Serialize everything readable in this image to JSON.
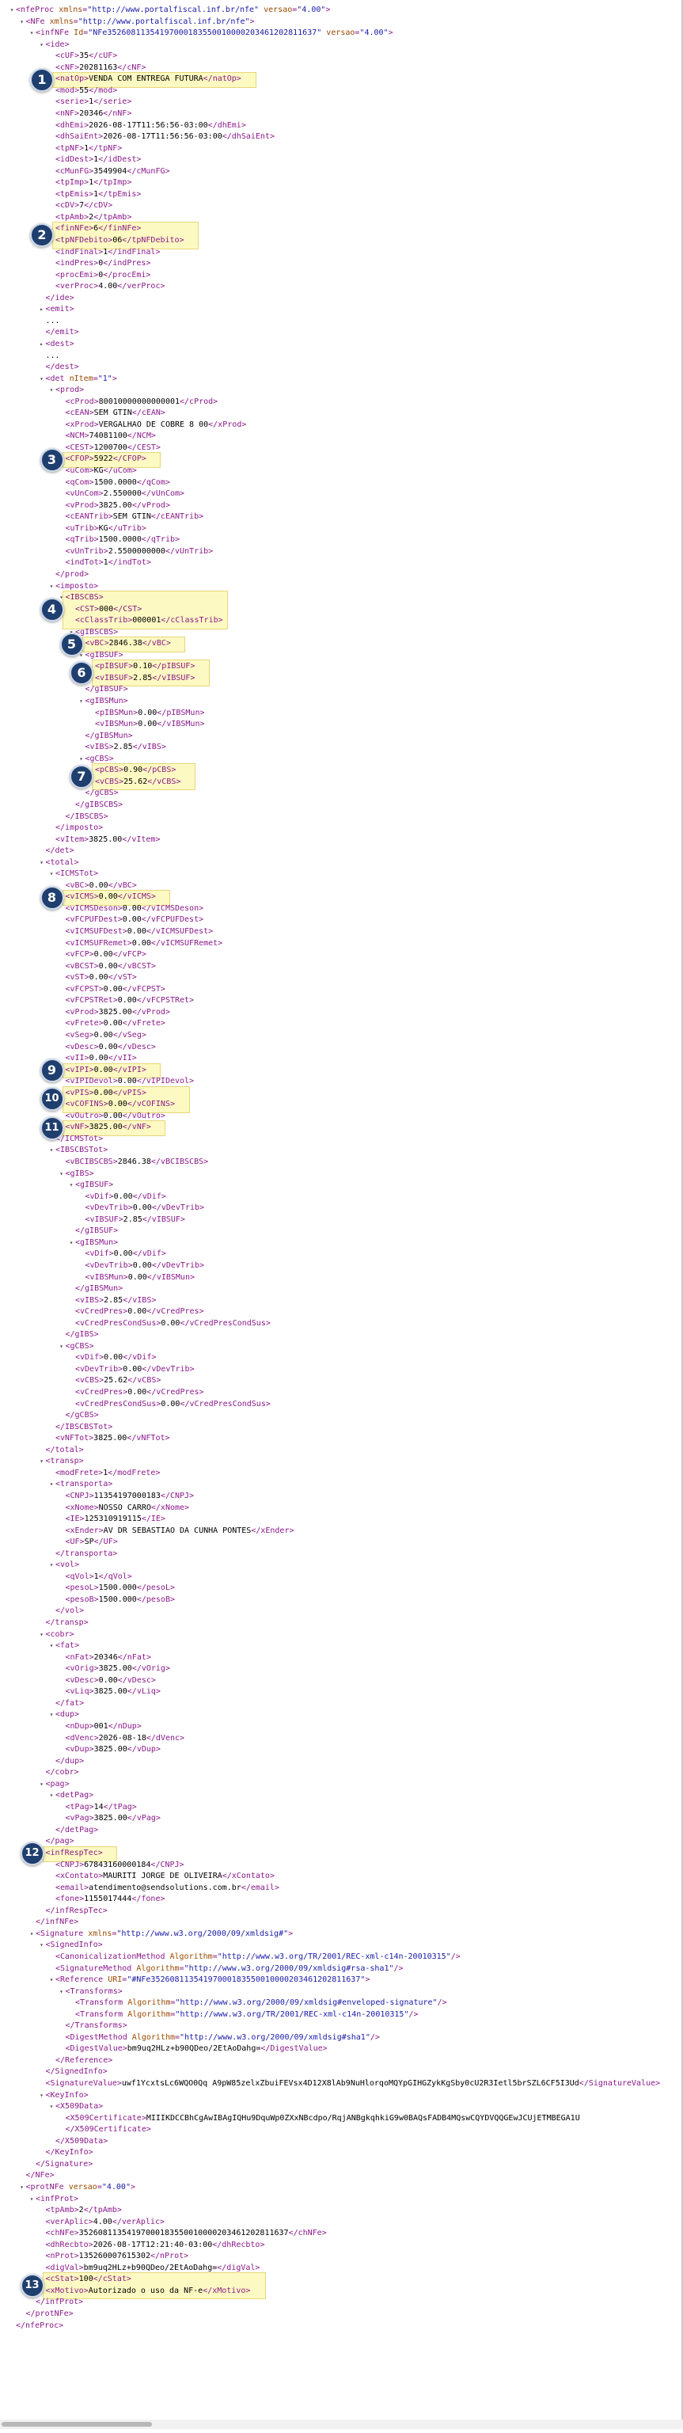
{
  "rows": [
    {
      "d": 0,
      "t": "▾",
      "s": "<nfeProc xmlns=\"http://www.portalfiscal.inf.br/nfe\" versao=\"4.00\">"
    },
    {
      "d": 1,
      "t": "▾",
      "s": "<NFe xmlns=\"http://www.portalfiscal.inf.br/nfe\">"
    },
    {
      "d": 2,
      "t": "▾",
      "s": "<infNFe Id=\"NFe35260811354197000183550010000203461202811637\" versao=\"4.00\">"
    },
    {
      "d": 3,
      "t": "▾",
      "s": "<ide>"
    },
    {
      "d": 4,
      "t": "",
      "s": "<cUF>35</cUF>"
    },
    {
      "d": 4,
      "t": "",
      "s": "<cNF>20281163</cNF>"
    },
    {
      "d": 4,
      "t": "",
      "s": "<natOp>VENDA COM ENTREGA FUTURA</natOp>"
    },
    {
      "d": 4,
      "t": "",
      "s": "<mod>55</mod>"
    },
    {
      "d": 4,
      "t": "",
      "s": "<serie>1</serie>"
    },
    {
      "d": 4,
      "t": "",
      "s": "<nNF>20346</nNF>"
    },
    {
      "d": 4,
      "t": "",
      "s": "<dhEmi>2026-08-17T11:56:56-03:00</dhEmi>"
    },
    {
      "d": 4,
      "t": "",
      "s": "<dhSaiEnt>2026-08-17T11:56:56-03:00</dhSaiEnt>"
    },
    {
      "d": 4,
      "t": "",
      "s": "<tpNF>1</tpNF>"
    },
    {
      "d": 4,
      "t": "",
      "s": "<idDest>1</idDest>"
    },
    {
      "d": 4,
      "t": "",
      "s": "<cMunFG>3549904</cMunFG>"
    },
    {
      "d": 4,
      "t": "",
      "s": "<tpImp>1</tpImp>"
    },
    {
      "d": 4,
      "t": "",
      "s": "<tpEmis>1</tpEmis>"
    },
    {
      "d": 4,
      "t": "",
      "s": "<cDV>7</cDV>"
    },
    {
      "d": 4,
      "t": "",
      "s": "<tpAmb>2</tpAmb>"
    },
    {
      "d": 4,
      "t": "",
      "s": "<finNFe>6</finNFe>"
    },
    {
      "d": 4,
      "t": "",
      "s": "<tpNFDebito>06</tpNFDebito>"
    },
    {
      "d": 4,
      "t": "",
      "s": "<indFinal>1</indFinal>"
    },
    {
      "d": 4,
      "t": "",
      "s": "<indPres>0</indPres>"
    },
    {
      "d": 4,
      "t": "",
      "s": "<procEmi>0</procEmi>"
    },
    {
      "d": 4,
      "t": "",
      "s": "<verProc>4.00</verProc>"
    },
    {
      "d": 3,
      "t": "",
      "s": "</ide>"
    },
    {
      "d": 3,
      "t": "▸",
      "s": "<emit>"
    },
    {
      "d": 3,
      "t": "",
      "s": "..."
    },
    {
      "d": 3,
      "t": "",
      "s": "</emit>"
    },
    {
      "d": 3,
      "t": "▸",
      "s": "<dest>"
    },
    {
      "d": 3,
      "t": "",
      "s": "..."
    },
    {
      "d": 3,
      "t": "",
      "s": "</dest>"
    },
    {
      "d": 3,
      "t": "▾",
      "s": "<det nItem=\"1\">"
    },
    {
      "d": 4,
      "t": "▾",
      "s": "<prod>"
    },
    {
      "d": 5,
      "t": "",
      "s": "<cProd>80010000000000001</cProd>"
    },
    {
      "d": 5,
      "t": "",
      "s": "<cEAN>SEM GTIN</cEAN>"
    },
    {
      "d": 5,
      "t": "",
      "s": "<xProd>VERGALHAO DE COBRE 8 00</xProd>"
    },
    {
      "d": 5,
      "t": "",
      "s": "<NCM>74081100</NCM>"
    },
    {
      "d": 5,
      "t": "",
      "s": "<CEST>1200700</CEST>"
    },
    {
      "d": 5,
      "t": "",
      "s": "<CFOP>5922</CFOP>"
    },
    {
      "d": 5,
      "t": "",
      "s": "<uCom>KG</uCom>"
    },
    {
      "d": 5,
      "t": "",
      "s": "<qCom>1500.0000</qCom>"
    },
    {
      "d": 5,
      "t": "",
      "s": "<vUnCom>2.550000</vUnCom>"
    },
    {
      "d": 5,
      "t": "",
      "s": "<vProd>3825.00</vProd>"
    },
    {
      "d": 5,
      "t": "",
      "s": "<cEANTrib>SEM GTIN</cEANTrib>"
    },
    {
      "d": 5,
      "t": "",
      "s": "<uTrib>KG</uTrib>"
    },
    {
      "d": 5,
      "t": "",
      "s": "<qTrib>1500.0000</qTrib>"
    },
    {
      "d": 5,
      "t": "",
      "s": "<vUnTrib>2.5500000000</vUnTrib>"
    },
    {
      "d": 5,
      "t": "",
      "s": "<indTot>1</indTot>"
    },
    {
      "d": 4,
      "t": "",
      "s": "</prod>"
    },
    {
      "d": 4,
      "t": "▾",
      "s": "<imposto>"
    },
    {
      "d": 5,
      "t": "▾",
      "s": "<IBSCBS>"
    },
    {
      "d": 6,
      "t": "",
      "s": "<CST>000</CST>"
    },
    {
      "d": 6,
      "t": "",
      "s": "<cClassTrib>000001</cClassTrib>"
    },
    {
      "d": 6,
      "t": "▾",
      "s": "<gIBSCBS>"
    },
    {
      "d": 7,
      "t": "",
      "s": "<vBC>2846.38</vBC>"
    },
    {
      "d": 7,
      "t": "▾",
      "s": "<gIBSUF>"
    },
    {
      "d": 8,
      "t": "",
      "s": "<pIBSUF>0.10</pIBSUF>"
    },
    {
      "d": 8,
      "t": "",
      "s": "<vIBSUF>2.85</vIBSUF>"
    },
    {
      "d": 7,
      "t": "",
      "s": "</gIBSUF>"
    },
    {
      "d": 7,
      "t": "▾",
      "s": "<gIBSMun>"
    },
    {
      "d": 8,
      "t": "",
      "s": "<pIBSMun>0.00</pIBSMun>"
    },
    {
      "d": 8,
      "t": "",
      "s": "<vIBSMun>0.00</vIBSMun>"
    },
    {
      "d": 7,
      "t": "",
      "s": "</gIBSMun>"
    },
    {
      "d": 7,
      "t": "",
      "s": "<vIBS>2.85</vIBS>"
    },
    {
      "d": 7,
      "t": "▾",
      "s": "<gCBS>"
    },
    {
      "d": 8,
      "t": "",
      "s": "<pCBS>0.90</pCBS>"
    },
    {
      "d": 8,
      "t": "",
      "s": "<vCBS>25.62</vCBS>"
    },
    {
      "d": 7,
      "t": "",
      "s": "</gCBS>"
    },
    {
      "d": 6,
      "t": "",
      "s": "</gIBSCBS>"
    },
    {
      "d": 5,
      "t": "",
      "s": "</IBSCBS>"
    },
    {
      "d": 4,
      "t": "",
      "s": "</imposto>"
    },
    {
      "d": 4,
      "t": "",
      "s": "<vItem>3825.00</vItem>"
    },
    {
      "d": 3,
      "t": "",
      "s": "</det>"
    },
    {
      "d": 3,
      "t": "▾",
      "s": "<total>"
    },
    {
      "d": 4,
      "t": "▾",
      "s": "<ICMSTot>"
    },
    {
      "d": 5,
      "t": "",
      "s": "<vBC>0.00</vBC>"
    },
    {
      "d": 5,
      "t": "",
      "s": "<vICMS>0.00</vICMS>"
    },
    {
      "d": 5,
      "t": "",
      "s": "<vICMSDeson>0.00</vICMSDeson>"
    },
    {
      "d": 5,
      "t": "",
      "s": "<vFCPUFDest>0.00</vFCPUFDest>"
    },
    {
      "d": 5,
      "t": "",
      "s": "<vICMSUFDest>0.00</vICMSUFDest>"
    },
    {
      "d": 5,
      "t": "",
      "s": "<vICMSUFRemet>0.00</vICMSUFRemet>"
    },
    {
      "d": 5,
      "t": "",
      "s": "<vFCP>0.00</vFCP>"
    },
    {
      "d": 5,
      "t": "",
      "s": "<vBCST>0.00</vBCST>"
    },
    {
      "d": 5,
      "t": "",
      "s": "<vST>0.00</vST>"
    },
    {
      "d": 5,
      "t": "",
      "s": "<vFCPST>0.00</vFCPST>"
    },
    {
      "d": 5,
      "t": "",
      "s": "<vFCPSTRet>0.00</vFCPSTRet>"
    },
    {
      "d": 5,
      "t": "",
      "s": "<vProd>3825.00</vProd>"
    },
    {
      "d": 5,
      "t": "",
      "s": "<vFrete>0.00</vFrete>"
    },
    {
      "d": 5,
      "t": "",
      "s": "<vSeg>0.00</vSeg>"
    },
    {
      "d": 5,
      "t": "",
      "s": "<vDesc>0.00</vDesc>"
    },
    {
      "d": 5,
      "t": "",
      "s": "<vII>0.00</vII>"
    },
    {
      "d": 5,
      "t": "",
      "s": "<vIPI>0.00</vIPI>"
    },
    {
      "d": 5,
      "t": "",
      "s": "<vIPIDevol>0.00</vIPIDevol>"
    },
    {
      "d": 5,
      "t": "",
      "s": "<vPIS>0.00</vPIS>"
    },
    {
      "d": 5,
      "t": "",
      "s": "<vCOFINS>0.00</vCOFINS>"
    },
    {
      "d": 5,
      "t": "",
      "s": "<vOutro>0.00</vOutro>"
    },
    {
      "d": 5,
      "t": "",
      "s": "<vNF>3825.00</vNF>"
    },
    {
      "d": 4,
      "t": "",
      "s": "</ICMSTot>"
    },
    {
      "d": 4,
      "t": "▾",
      "s": "<IBSCBSTot>"
    },
    {
      "d": 5,
      "t": "",
      "s": "<vBCIBSCBS>2846.38</vBCIBSCBS>"
    },
    {
      "d": 5,
      "t": "▾",
      "s": "<gIBS>"
    },
    {
      "d": 6,
      "t": "▾",
      "s": "<gIBSUF>"
    },
    {
      "d": 7,
      "t": "",
      "s": "<vDif>0.00</vDif>"
    },
    {
      "d": 7,
      "t": "",
      "s": "<vDevTrib>0.00</vDevTrib>"
    },
    {
      "d": 7,
      "t": "",
      "s": "<vIBSUF>2.85</vIBSUF>"
    },
    {
      "d": 6,
      "t": "",
      "s": "</gIBSUF>"
    },
    {
      "d": 6,
      "t": "▾",
      "s": "<gIBSMun>"
    },
    {
      "d": 7,
      "t": "",
      "s": "<vDif>0.00</vDif>"
    },
    {
      "d": 7,
      "t": "",
      "s": "<vDevTrib>0.00</vDevTrib>"
    },
    {
      "d": 7,
      "t": "",
      "s": "<vIBSMun>0.00</vIBSMun>"
    },
    {
      "d": 6,
      "t": "",
      "s": "</gIBSMun>"
    },
    {
      "d": 6,
      "t": "",
      "s": "<vIBS>2.85</vIBS>"
    },
    {
      "d": 6,
      "t": "",
      "s": "<vCredPres>0.00</vCredPres>"
    },
    {
      "d": 6,
      "t": "",
      "s": "<vCredPresCondSus>0.00</vCredPresCondSus>"
    },
    {
      "d": 5,
      "t": "",
      "s": "</gIBS>"
    },
    {
      "d": 5,
      "t": "▾",
      "s": "<gCBS>"
    },
    {
      "d": 6,
      "t": "",
      "s": "<vDif>0.00</vDif>"
    },
    {
      "d": 6,
      "t": "",
      "s": "<vDevTrib>0.00</vDevTrib>"
    },
    {
      "d": 6,
      "t": "",
      "s": "<vCBS>25.62</vCBS>"
    },
    {
      "d": 6,
      "t": "",
      "s": "<vCredPres>0.00</vCredPres>"
    },
    {
      "d": 6,
      "t": "",
      "s": "<vCredPresCondSus>0.00</vCredPresCondSus>"
    },
    {
      "d": 5,
      "t": "",
      "s": "</gCBS>"
    },
    {
      "d": 4,
      "t": "",
      "s": "</IBSCBSTot>"
    },
    {
      "d": 4,
      "t": "",
      "s": "<vNFTot>3825.00</vNFTot>"
    },
    {
      "d": 3,
      "t": "",
      "s": "</total>"
    },
    {
      "d": 3,
      "t": "▾",
      "s": "<transp>"
    },
    {
      "d": 4,
      "t": "",
      "s": "<modFrete>1</modFrete>"
    },
    {
      "d": 4,
      "t": "▾",
      "s": "<transporta>"
    },
    {
      "d": 5,
      "t": "",
      "s": "<CNPJ>11354197000183</CNPJ>"
    },
    {
      "d": 5,
      "t": "",
      "s": "<xNome>NOSSO CARRO</xNome>"
    },
    {
      "d": 5,
      "t": "",
      "s": "<IE>125310919115</IE>"
    },
    {
      "d": 5,
      "t": "",
      "s": "<xEnder>AV DR SEBASTIAO DA CUNHA PONTES</xEnder>"
    },
    {
      "d": 5,
      "t": "",
      "s": "<UF>SP</UF>"
    },
    {
      "d": 4,
      "t": "",
      "s": "</transporta>"
    },
    {
      "d": 4,
      "t": "▾",
      "s": "<vol>"
    },
    {
      "d": 5,
      "t": "",
      "s": "<qVol>1</qVol>"
    },
    {
      "d": 5,
      "t": "",
      "s": "<pesoL>1500.000</pesoL>"
    },
    {
      "d": 5,
      "t": "",
      "s": "<pesoB>1500.000</pesoB>"
    },
    {
      "d": 4,
      "t": "",
      "s": "</vol>"
    },
    {
      "d": 3,
      "t": "",
      "s": "</transp>"
    },
    {
      "d": 3,
      "t": "▾",
      "s": "<cobr>"
    },
    {
      "d": 4,
      "t": "▾",
      "s": "<fat>"
    },
    {
      "d": 5,
      "t": "",
      "s": "<nFat>20346</nFat>"
    },
    {
      "d": 5,
      "t": "",
      "s": "<vOrig>3825.00</vOrig>"
    },
    {
      "d": 5,
      "t": "",
      "s": "<vDesc>0.00</vDesc>"
    },
    {
      "d": 5,
      "t": "",
      "s": "<vLiq>3825.00</vLiq>"
    },
    {
      "d": 4,
      "t": "",
      "s": "</fat>"
    },
    {
      "d": 4,
      "t": "▾",
      "s": "<dup>"
    },
    {
      "d": 5,
      "t": "",
      "s": "<nDup>001</nDup>"
    },
    {
      "d": 5,
      "t": "",
      "s": "<dVenc>2026-08-18</dVenc>"
    },
    {
      "d": 5,
      "t": "",
      "s": "<vDup>3825.00</vDup>"
    },
    {
      "d": 4,
      "t": "",
      "s": "</dup>"
    },
    {
      "d": 3,
      "t": "",
      "s": "</cobr>"
    },
    {
      "d": 3,
      "t": "▾",
      "s": "<pag>"
    },
    {
      "d": 4,
      "t": "▾",
      "s": "<detPag>"
    },
    {
      "d": 5,
      "t": "",
      "s": "<tPag>14</tPag>"
    },
    {
      "d": 5,
      "t": "",
      "s": "<vPag>3825.00</vPag>"
    },
    {
      "d": 4,
      "t": "",
      "s": "</detPag>"
    },
    {
      "d": 3,
      "t": "",
      "s": "</pag>"
    },
    {
      "d": 3,
      "t": "▾",
      "s": "<infRespTec>"
    },
    {
      "d": 4,
      "t": "",
      "s": "<CNPJ>67843160000184</CNPJ>"
    },
    {
      "d": 4,
      "t": "",
      "s": "<xContato>MAURITI JORGE DE OLIVEIRA</xContato>"
    },
    {
      "d": 4,
      "t": "",
      "s": "<email>atendimento@sendsolutions.com.br</email>"
    },
    {
      "d": 4,
      "t": "",
      "s": "<fone>1155017444</fone>"
    },
    {
      "d": 3,
      "t": "",
      "s": "</infRespTec>"
    },
    {
      "d": 2,
      "t": "",
      "s": "</infNFe>"
    },
    {
      "d": 2,
      "t": "▾",
      "s": "<Signature xmlns=\"http://www.w3.org/2000/09/xmldsig#\">"
    },
    {
      "d": 3,
      "t": "▾",
      "s": "<SignedInfo>"
    },
    {
      "d": 4,
      "t": "",
      "s": "<CanonicalizationMethod Algorithm=\"http://www.w3.org/TR/2001/REC-xml-c14n-20010315\"/>"
    },
    {
      "d": 4,
      "t": "",
      "s": "<SignatureMethod Algorithm=\"http://www.w3.org/2000/09/xmldsig#rsa-sha1\"/>"
    },
    {
      "d": 4,
      "t": "▾",
      "s": "<Reference URI=\"#NFe35260811354197000183550010000203461202811637\">"
    },
    {
      "d": 5,
      "t": "▾",
      "s": "<Transforms>"
    },
    {
      "d": 6,
      "t": "",
      "s": "<Transform Algorithm=\"http://www.w3.org/2000/09/xmldsig#enveloped-signature\"/>"
    },
    {
      "d": 6,
      "t": "",
      "s": "<Transform Algorithm=\"http://www.w3.org/TR/2001/REC-xml-c14n-20010315\"/>"
    },
    {
      "d": 5,
      "t": "",
      "s": "</Transforms>"
    },
    {
      "d": 5,
      "t": "",
      "s": "<DigestMethod Algorithm=\"http://www.w3.org/2000/09/xmldsig#sha1\"/>"
    },
    {
      "d": 5,
      "t": "",
      "s": "<DigestValue>bm9uq2HLz+b90QDeo/2EtAoDahg=</DigestValue>"
    },
    {
      "d": 4,
      "t": "",
      "s": "</Reference>"
    },
    {
      "d": 3,
      "t": "",
      "s": "</SignedInfo>"
    },
    {
      "d": 3,
      "t": "",
      "s": "<SignatureValue>uwf1YcxtsLc6WQO0Qq A9pW85zelxZbuiFEVsx4D12X8lAb9NuHlorqoMQYpGIHGZykKgSby0cU2R3Ietl5brSZL6CF5I3Ud</SignatureValue>"
    },
    {
      "d": 3,
      "t": "▾",
      "s": "<KeyInfo>"
    },
    {
      "d": 4,
      "t": "▾",
      "s": "<X509Data>"
    },
    {
      "d": 5,
      "t": "",
      "s": "<X509Certificate>MIIIKDCCBhCgAwIBAgIQHu9DquWp0ZXxNBcdpo/RqjANBgkqhkiG9w0BAQsFADB4MQswCQYDVQQGEwJCUjETMBEGA1U"
    },
    {
      "d": 5,
      "t": "",
      "s": "</X509Certificate>"
    },
    {
      "d": 4,
      "t": "",
      "s": "</X509Data>"
    },
    {
      "d": 3,
      "t": "",
      "s": "</KeyInfo>"
    },
    {
      "d": 2,
      "t": "",
      "s": "</Signature>"
    },
    {
      "d": 1,
      "t": "",
      "s": "</NFe>"
    },
    {
      "d": 1,
      "t": "▾",
      "s": "<protNFe versao=\"4.00\">"
    },
    {
      "d": 2,
      "t": "▾",
      "s": "<infProt>"
    },
    {
      "d": 3,
      "t": "",
      "s": "<tpAmb>2</tpAmb>"
    },
    {
      "d": 3,
      "t": "",
      "s": "<verAplic>4.00</verAplic>"
    },
    {
      "d": 3,
      "t": "",
      "s": "<chNFe>35260811354197000183550010000203461202811637</chNFe>"
    },
    {
      "d": 3,
      "t": "",
      "s": "<dhRecbto>2026-08-17T12:21:40-03:00</dhRecbto>"
    },
    {
      "d": 3,
      "t": "",
      "s": "<nProt>135260007615302</nProt>"
    },
    {
      "d": 3,
      "t": "",
      "s": "<digVal>bm9uq2HLz+b90QDeo/2EtAoDahg=</digVal>"
    },
    {
      "d": 3,
      "t": "",
      "s": "<cStat>100</cStat>"
    },
    {
      "d": 3,
      "t": "",
      "s": "<xMotivo>Autorizado o uso da NF-e</xMotivo>"
    },
    {
      "d": 2,
      "t": "",
      "s": "</infProt>"
    },
    {
      "d": 1,
      "t": "",
      "s": "</protNFe>"
    },
    {
      "d": 0,
      "t": "",
      "s": "</nfeProc>"
    }
  ],
  "callouts": [
    {
      "n": "1",
      "rows": [
        6,
        6
      ]
    },
    {
      "n": "2",
      "rows": [
        19,
        20
      ]
    },
    {
      "n": "3",
      "rows": [
        39,
        39
      ]
    },
    {
      "n": "4",
      "rows": [
        51,
        53
      ]
    },
    {
      "n": "5",
      "rows": [
        55,
        55
      ]
    },
    {
      "n": "6",
      "rows": [
        57,
        58
      ]
    },
    {
      "n": "7",
      "rows": [
        66,
        67
      ]
    },
    {
      "n": "8",
      "rows": [
        77,
        77
      ]
    },
    {
      "n": "9",
      "rows": [
        92,
        92
      ]
    },
    {
      "n": "10",
      "rows": [
        94,
        95
      ]
    },
    {
      "n": "11",
      "rows": [
        97,
        97
      ]
    },
    {
      "n": "12",
      "rows": [
        160,
        160
      ]
    },
    {
      "n": "13",
      "rows": [
        197,
        198
      ]
    }
  ],
  "colors": {
    "tag": "#8a1a8a",
    "text": "#000000",
    "highlight": "#fdf9c2",
    "badge": "#1f3f6e"
  }
}
